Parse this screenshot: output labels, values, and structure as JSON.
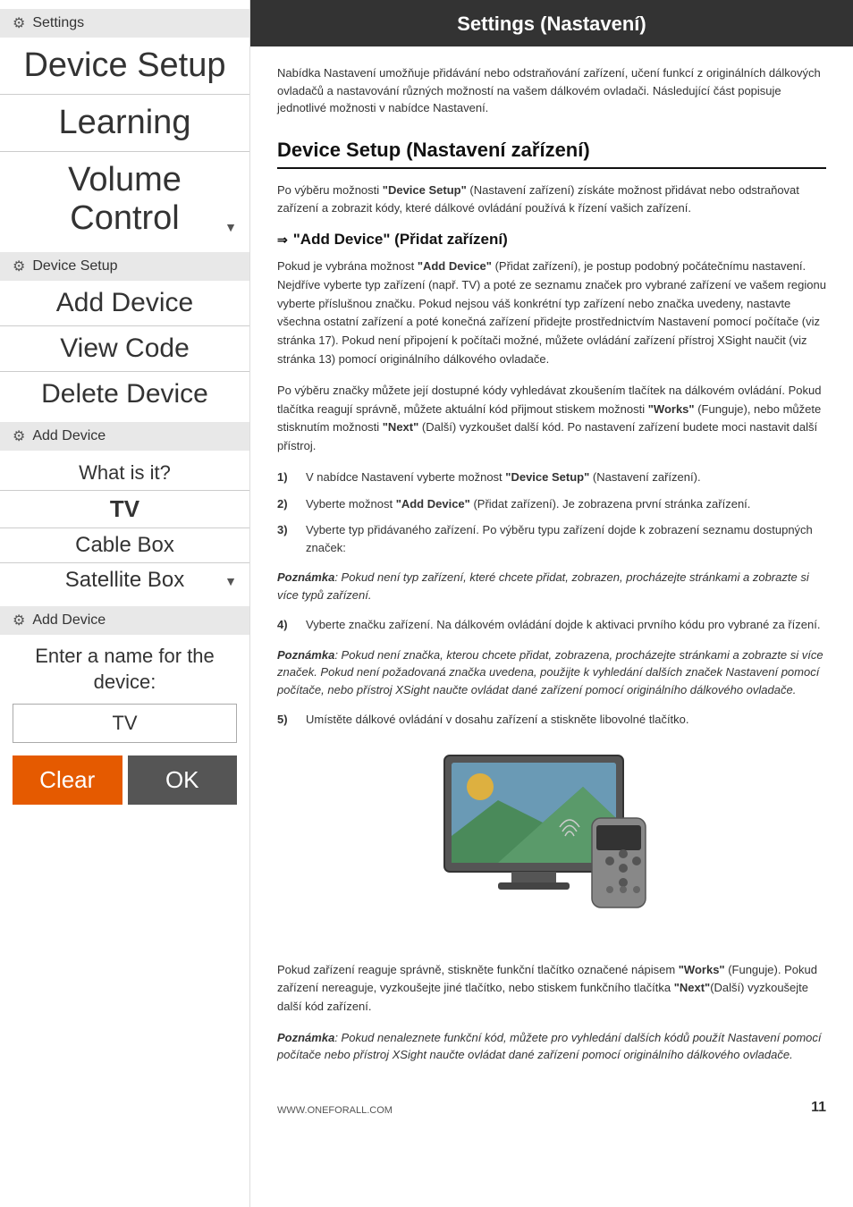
{
  "sidebar": {
    "section1": {
      "header": "Settings",
      "items": [
        {
          "label": "Device Setup",
          "size": "large"
        },
        {
          "label": "Learning",
          "size": "large"
        },
        {
          "label": "Volume Control",
          "size": "large",
          "hasDropdown": true
        }
      ]
    },
    "section2": {
      "header": "Device Setup",
      "items": [
        {
          "label": "Add Device"
        },
        {
          "label": "View Code"
        },
        {
          "label": "Delete Device"
        }
      ]
    },
    "section3": {
      "header": "Add Device",
      "whatLabel": "What is it?",
      "deviceTypes": [
        {
          "label": "TV",
          "selected": true
        },
        {
          "label": "Cable Box"
        },
        {
          "label": "Satellite Box",
          "hasDropdown": true
        }
      ]
    },
    "section4": {
      "header": "Add Device",
      "namePrompt": "Enter a name for the device:",
      "nameValue": "TV",
      "clearLabel": "Clear",
      "okLabel": "OK"
    }
  },
  "main": {
    "title": "Settings (Nastavení)",
    "intro": "Nabídka Nastavení umožňuje přidávání nebo odstraňování zařízení, učení funkcí z originálních dálkových ovladačů a nastavování různých možností na vašem dálkovém ovladači. Následující část popisuje jednotlivé možnosti v nabídce Nastavení.",
    "deviceSetup": {
      "heading": "Device Setup (Nastavení zařízení)",
      "intro": "Po výběru možnosti \"Device Setup\" (Nastavení zařízení) získáte možnost přidávat nebo odstraňovat zařízení a zobrazit kódy, které dálkové ovládání používá k řízení vašich zařízení.",
      "addDeviceSection": {
        "heading": "\"Add Device\" (Přidat zařízení)",
        "body1": "Pokud je vybrána možnost \"Add Device\" (Přidat zařízení), je postup podobný počátečnímu nastavení. Nejdříve vyberte typ zařízení (např. TV) a poté ze seznamu značek pro vybrané zařízení ve vašem regionu vyberte příslušnou značku. Pokud nejsou váš konkrétní typ zařízení nebo značka uvedeny, nastavte všechna ostatní zařízení a poté konečná zařízení přidejte prostřednictvím Nastavení pomocí počítače (viz stránka 17). Pokud není připojení k počítači možné, můžete ovládání zařízení přístroj XSight naučit (viz stránka 13) pomocí originálního dálkového ovladače.",
        "body2": "Po výběru značky můžete její dostupné kódy vyhledávat zkoušením tlačítek na dálkovém ovládání. Pokud tlačítka reagují správně, můžete aktuální kód přijmout stiskem možnosti \"Works\" (Funguje), nebo můžete stisknutím možnosti \"Next\" (Další) vyzkoušet další kód. Po nastavení zařízení budete moci nastavit další přístroj.",
        "steps": [
          {
            "num": "1)",
            "text": "V nabídce Nastavení vyberte možnost \"Device Setup\" (Nastavení zařízení)."
          },
          {
            "num": "2)",
            "text": "Vyberte možnost \"Add Device\" (Přidat zařízení). Je zobrazena první stránka zařízení."
          },
          {
            "num": "3)",
            "text": "Vyberte typ přidávaného zařízení. Po výběru typu zařízení dojde k zobrazení seznamu dostupných značek:"
          }
        ],
        "note1": "Poznámka: Pokud není typ zařízení, které chcete přidat, zobrazen, procházejte stránkami a zobrazte si více typů zařízení.",
        "step4": {
          "num": "4)",
          "text": "Vyberte značku zařízení. Na dálkovém ovládání dojde k aktivaci prvního kódu pro vybrané za řízení."
        },
        "note2": "Poznámka: Pokud není značka, kterou chcete přidat, zobrazena, procházejte stránkami a zobrazte si více značek.  Pokud není požadovaná značka uvedena, použijte k vyhledání dalších značek Nastavení pomocí počítače, nebo přístroj XSight naučte ovládat dané zařízení pomocí originálního dálkového ovladače.",
        "step5": {
          "num": "5)",
          "text": "Umístěte dálkové ovládání v dosahu zařízení a stiskněte libovolné tlačítko."
        },
        "footer1": "Pokud zařízení reaguje správně, stiskněte funkční tlačítko označené nápisem \"Works\" (Funguje). Pokud zařízení nereaguje, vyzkoušejte jiné tlačítko, nebo stiskem funkčního tlačítka \"Next\"(Další) vyzkoušejte další kód zařízení.",
        "note3": "Poznámka: Pokud nenaleznete funkční kód, můžete pro vyhledání dalších kódů použít Nastavení pomocí počítače nebo přístroj XSight naučte ovládat dané zařízení pomocí originálního dálkového ovladače."
      }
    }
  },
  "footer": {
    "url": "WWW.ONEFORALL.COM",
    "pageNum": "11"
  }
}
